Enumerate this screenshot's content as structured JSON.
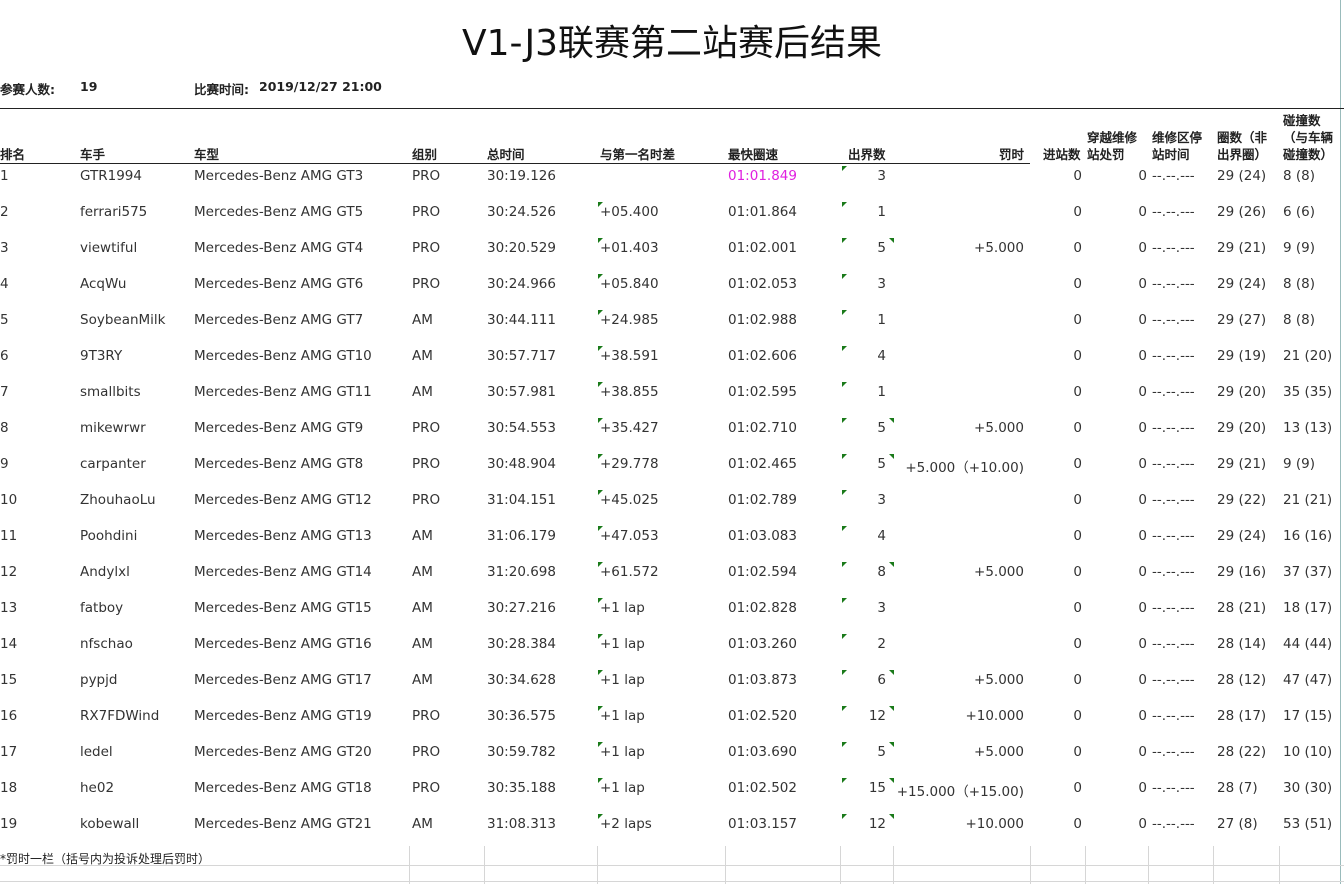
{
  "title": "V1-J3联赛第二站赛后结果",
  "meta": {
    "participants_label": "参赛人数:",
    "participants_value": "19",
    "time_label": "比赛时间:",
    "time_value": "2019/12/27 21:00"
  },
  "headers": {
    "rank": "排名",
    "driver": "车手",
    "car": "车型",
    "group": "组别",
    "total": "总时间",
    "gap": "与第一名时差",
    "best": "最快圈速",
    "outs": "出界数",
    "penalty": "罚时",
    "pit_in": "进站数",
    "pit_cross": "穿越维修站处罚",
    "pit_stop": "维修区停站时间",
    "laps": "圈数（非出界圈）",
    "collisions": "碰撞数（与车辆碰撞数）"
  },
  "rows": [
    {
      "rank": "1",
      "driver": "GTR1994",
      "car": "Mercedes-Benz AMG GT3",
      "group": "PRO",
      "total": "30:19.126",
      "gap": "",
      "best": "01:01.849",
      "outs": "3",
      "penalty": "",
      "pit_in": "0",
      "pit_cross": "0",
      "pit_stop": "--.--.---",
      "laps": "29 (24)",
      "collisions": "8 (8)"
    },
    {
      "rank": "2",
      "driver": "ferrari575",
      "car": "Mercedes-Benz AMG GT5",
      "group": "PRO",
      "total": "30:24.526",
      "gap": "+05.400",
      "best": "01:01.864",
      "outs": "1",
      "penalty": "",
      "pit_in": "0",
      "pit_cross": "0",
      "pit_stop": "--.--.---",
      "laps": "29 (26)",
      "collisions": "6 (6)"
    },
    {
      "rank": "3",
      "driver": "viewtiful",
      "car": "Mercedes-Benz AMG GT4",
      "group": "PRO",
      "total": "30:20.529",
      "gap": "+01.403",
      "best": "01:02.001",
      "outs": "5",
      "penalty": "+5.000",
      "pit_in": "0",
      "pit_cross": "0",
      "pit_stop": "--.--.---",
      "laps": "29 (21)",
      "collisions": "9 (9)"
    },
    {
      "rank": "4",
      "driver": "AcqWu",
      "car": "Mercedes-Benz AMG GT6",
      "group": "PRO",
      "total": "30:24.966",
      "gap": "+05.840",
      "best": "01:02.053",
      "outs": "3",
      "penalty": "",
      "pit_in": "0",
      "pit_cross": "0",
      "pit_stop": "--.--.---",
      "laps": "29 (24)",
      "collisions": "8 (8)"
    },
    {
      "rank": "5",
      "driver": "SoybeanMilk",
      "car": "Mercedes-Benz AMG GT7",
      "group": "AM",
      "total": "30:44.111",
      "gap": "+24.985",
      "best": "01:02.988",
      "outs": "1",
      "penalty": "",
      "pit_in": "0",
      "pit_cross": "0",
      "pit_stop": "--.--.---",
      "laps": "29 (27)",
      "collisions": "8 (8)"
    },
    {
      "rank": "6",
      "driver": "9T3RY",
      "car": "Mercedes-Benz AMG GT10",
      "group": "AM",
      "total": "30:57.717",
      "gap": "+38.591",
      "best": "01:02.606",
      "outs": "4",
      "penalty": "",
      "pit_in": "0",
      "pit_cross": "0",
      "pit_stop": "--.--.---",
      "laps": "29 (19)",
      "collisions": "21 (20)"
    },
    {
      "rank": "7",
      "driver": "smallbits",
      "car": "Mercedes-Benz AMG GT11",
      "group": "AM",
      "total": "30:57.981",
      "gap": "+38.855",
      "best": "01:02.595",
      "outs": "1",
      "penalty": "",
      "pit_in": "0",
      "pit_cross": "0",
      "pit_stop": "--.--.---",
      "laps": "29 (20)",
      "collisions": "35 (35)"
    },
    {
      "rank": "8",
      "driver": "mikewrwr",
      "car": "Mercedes-Benz AMG GT9",
      "group": "PRO",
      "total": "30:54.553",
      "gap": "+35.427",
      "best": "01:02.710",
      "outs": "5",
      "penalty": "+5.000",
      "pit_in": "0",
      "pit_cross": "0",
      "pit_stop": "--.--.---",
      "laps": "29 (20)",
      "collisions": "13 (13)"
    },
    {
      "rank": "9",
      "driver": "carpanter",
      "car": "Mercedes-Benz AMG GT8",
      "group": "PRO",
      "total": "30:48.904",
      "gap": "+29.778",
      "best": "01:02.465",
      "outs": "5",
      "penalty": "+5.000（+10.00)",
      "pit_in": "0",
      "pit_cross": "0",
      "pit_stop": "--.--.---",
      "laps": "29 (21)",
      "collisions": "9 (9)"
    },
    {
      "rank": "10",
      "driver": "ZhouhaoLu",
      "car": "Mercedes-Benz AMG GT12",
      "group": "PRO",
      "total": "31:04.151",
      "gap": "+45.025",
      "best": "01:02.789",
      "outs": "3",
      "penalty": "",
      "pit_in": "0",
      "pit_cross": "0",
      "pit_stop": "--.--.---",
      "laps": "29 (22)",
      "collisions": "21 (21)"
    },
    {
      "rank": "11",
      "driver": "Poohdini",
      "car": "Mercedes-Benz AMG GT13",
      "group": "AM",
      "total": "31:06.179",
      "gap": "+47.053",
      "best": "01:03.083",
      "outs": "4",
      "penalty": "",
      "pit_in": "0",
      "pit_cross": "0",
      "pit_stop": "--.--.---",
      "laps": "29 (24)",
      "collisions": "16 (16)"
    },
    {
      "rank": "12",
      "driver": "Andylxl",
      "car": "Mercedes-Benz AMG GT14",
      "group": "AM",
      "total": "31:20.698",
      "gap": "+61.572",
      "best": "01:02.594",
      "outs": "8",
      "penalty": "+5.000",
      "pit_in": "0",
      "pit_cross": "0",
      "pit_stop": "--.--.---",
      "laps": "29 (16)",
      "collisions": "37 (37)"
    },
    {
      "rank": "13",
      "driver": "fatboy",
      "car": "Mercedes-Benz AMG GT15",
      "group": "AM",
      "total": "30:27.216",
      "gap": "+1 lap",
      "best": "01:02.828",
      "outs": "3",
      "penalty": "",
      "pit_in": "0",
      "pit_cross": "0",
      "pit_stop": "--.--.---",
      "laps": "28 (21)",
      "collisions": "18 (17)"
    },
    {
      "rank": "14",
      "driver": "nfschao",
      "car": "Mercedes-Benz AMG GT16",
      "group": "AM",
      "total": "30:28.384",
      "gap": "+1 lap",
      "best": "01:03.260",
      "outs": "2",
      "penalty": "",
      "pit_in": "0",
      "pit_cross": "0",
      "pit_stop": "--.--.---",
      "laps": "28 (14)",
      "collisions": "44 (44)"
    },
    {
      "rank": "15",
      "driver": "pypjd",
      "car": "Mercedes-Benz AMG GT17",
      "group": "AM",
      "total": "30:34.628",
      "gap": "+1 lap",
      "best": "01:03.873",
      "outs": "6",
      "penalty": "+5.000",
      "pit_in": "0",
      "pit_cross": "0",
      "pit_stop": "--.--.---",
      "laps": "28 (12)",
      "collisions": "47 (47)"
    },
    {
      "rank": "16",
      "driver": "RX7FDWind",
      "car": "Mercedes-Benz AMG GT19",
      "group": "PRO",
      "total": "30:36.575",
      "gap": "+1 lap",
      "best": "01:02.520",
      "outs": "12",
      "penalty": "+10.000",
      "pit_in": "0",
      "pit_cross": "0",
      "pit_stop": "--.--.---",
      "laps": "28 (17)",
      "collisions": "17 (15)"
    },
    {
      "rank": "17",
      "driver": "ledel",
      "car": "Mercedes-Benz AMG GT20",
      "group": "PRO",
      "total": "30:59.782",
      "gap": "+1 lap",
      "best": "01:03.690",
      "outs": "5",
      "penalty": "+5.000",
      "pit_in": "0",
      "pit_cross": "0",
      "pit_stop": "--.--.---",
      "laps": "28 (22)",
      "collisions": "10 (10)"
    },
    {
      "rank": "18",
      "driver": "he02",
      "car": "Mercedes-Benz AMG GT18",
      "group": "PRO",
      "total": "30:35.188",
      "gap": "+1 lap",
      "best": "01:02.502",
      "outs": "15",
      "penalty": "+15.000（+15.00)",
      "pit_in": "0",
      "pit_cross": "0",
      "pit_stop": "--.--.---",
      "laps": "28 (7)",
      "collisions": "30 (30)"
    },
    {
      "rank": "19",
      "driver": "kobewall",
      "car": "Mercedes-Benz AMG GT21",
      "group": "AM",
      "total": "31:08.313",
      "gap": "+2 laps",
      "best": "01:03.157",
      "outs": "12",
      "penalty": "+10.000",
      "pit_in": "0",
      "pit_cross": "0",
      "pit_stop": "--.--.---",
      "laps": "27 (8)",
      "collisions": "53 (51)"
    }
  ],
  "footnote": "*罚时一栏（括号内为投诉处理后罚时）",
  "colors": {
    "highlight": "#e020e0",
    "marker": "#1a7a1a"
  }
}
